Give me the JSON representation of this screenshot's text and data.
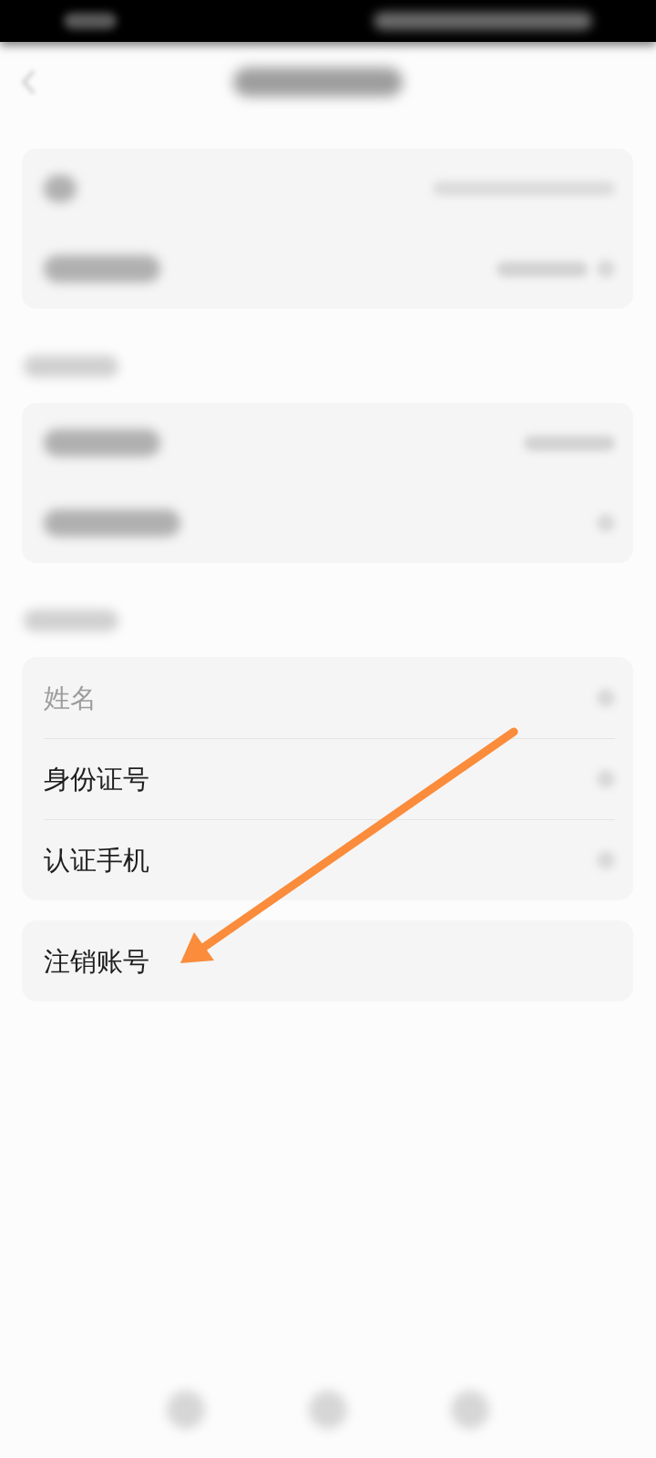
{
  "status_bar": {
    "kind": "blurred"
  },
  "header": {
    "kind": "blurred",
    "left": {
      "kind": "back"
    }
  },
  "cards": [
    {
      "kind": "plain",
      "rows": [
        {
          "kind": "blurred",
          "parts": [
            {
              "kind": "tag"
            },
            {
              "kind": "longvalue"
            }
          ]
        },
        {
          "kind": "blurred",
          "parts": [
            {
              "kind": "label"
            },
            {
              "kind": "value"
            },
            {
              "kind": "chevron"
            }
          ]
        }
      ]
    },
    {
      "kind": "headed",
      "rows": [
        {
          "kind": "blurred",
          "parts": [
            {
              "kind": "label"
            },
            {
              "kind": "value"
            }
          ]
        },
        {
          "kind": "blurred",
          "parts": [
            {
              "kind": "widelabel"
            },
            {
              "kind": "chevron"
            }
          ]
        }
      ]
    },
    {
      "kind": "headed",
      "rows": [
        {
          "kind": "text",
          "label": "姓名",
          "dimmed": true,
          "parts": [
            {
              "kind": "chevron"
            }
          ]
        },
        {
          "kind": "text",
          "label": "身份证号",
          "dimmed": false,
          "parts": [
            {
              "kind": "chevron"
            }
          ]
        },
        {
          "kind": "text",
          "label": "认证手机",
          "dimmed": false,
          "parts": [
            {
              "kind": "chevron"
            }
          ]
        }
      ]
    },
    {
      "kind": "plain",
      "rows": [
        {
          "kind": "text",
          "label": "注销账号",
          "dimmed": false
        }
      ]
    }
  ],
  "bottom_nav": {
    "kind": "blurred",
    "icons": [
      {
        "kind": "blurred"
      },
      {
        "kind": "blurred"
      },
      {
        "kind": "blurred"
      }
    ]
  },
  "annotation": {
    "kind": "arrow"
  }
}
